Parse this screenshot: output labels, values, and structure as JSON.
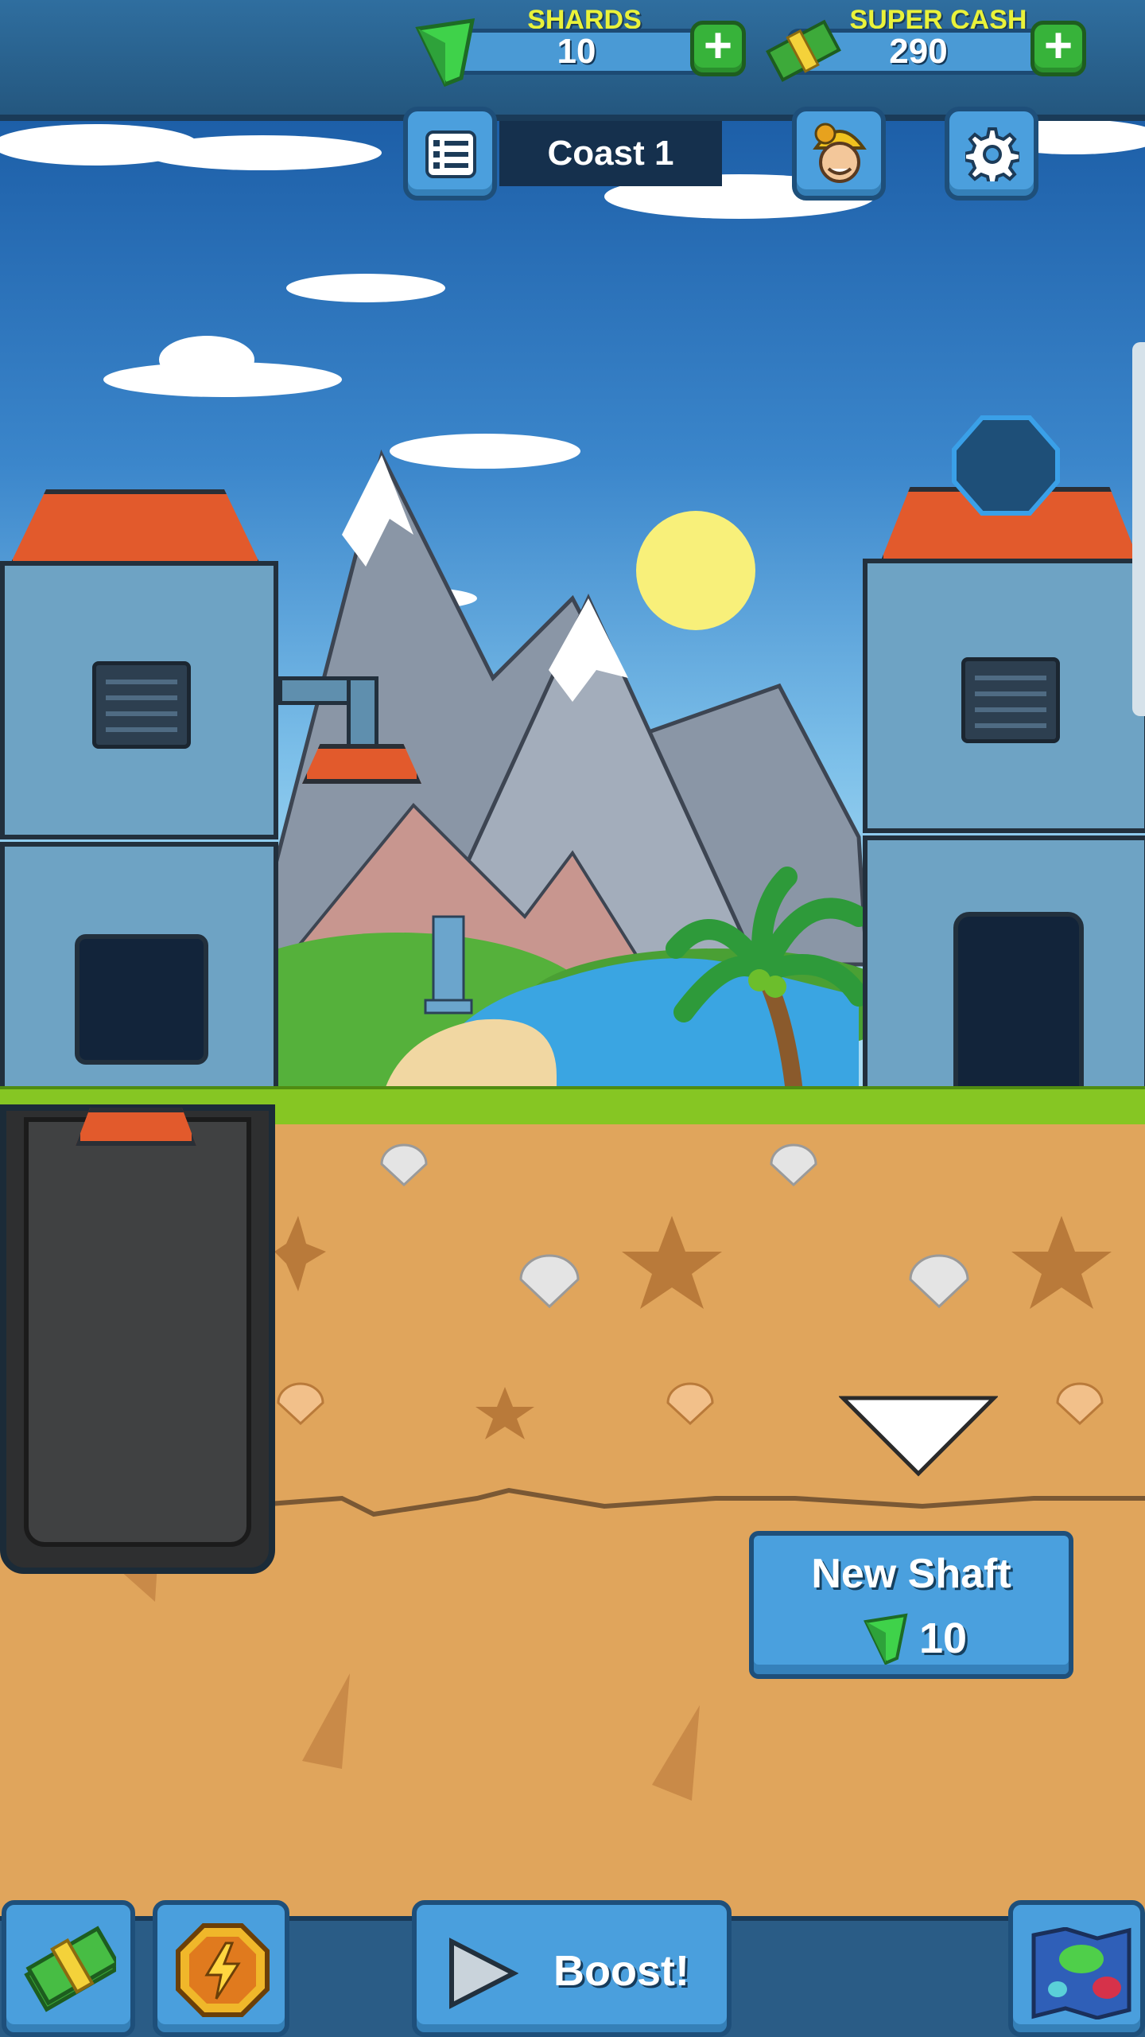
{
  "hud": {
    "shards": {
      "label": "SHARDS",
      "value": "10"
    },
    "super_cash": {
      "label": "SUPER CASH",
      "value": "290"
    },
    "mine_name": "Coast 1"
  },
  "actions": {
    "new_shaft": {
      "title": "New Shaft",
      "cost": "10"
    },
    "boost_label": "Boost!"
  },
  "colors": {
    "shard": "#3fd24a",
    "cash": "#3daa3a",
    "button": "#4a9fdd",
    "plus": "#37b33a",
    "roof": "#e25a2c",
    "dirt": "#e0a55c",
    "grass": "#86c623"
  },
  "icons": [
    "shard-icon",
    "cash-icon",
    "plus-icon",
    "list-icon",
    "avatar-icon",
    "gear-icon",
    "bolt-coin-icon",
    "play-icon",
    "map-icon",
    "down-arrow-icon"
  ]
}
